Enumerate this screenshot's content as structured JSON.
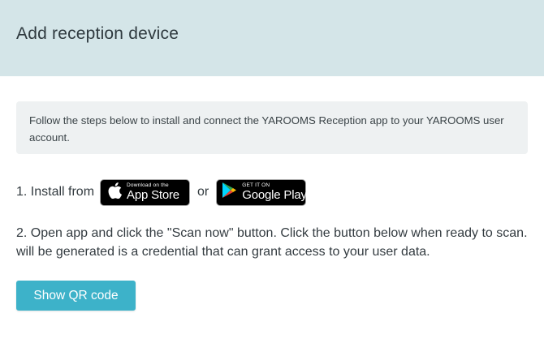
{
  "header": {
    "title": "Add reception device"
  },
  "info": {
    "text": "Follow the steps below to install and connect the YAROOMS Reception app to your YAROOMS user account."
  },
  "step1": {
    "label": "1. Install from",
    "or": "or",
    "app_store": {
      "small": "Download on the",
      "big": "App Store",
      "icon": "apple-icon"
    },
    "google_play": {
      "small": "GET IT ON",
      "big": "Google Play",
      "icon": "google-play-icon"
    }
  },
  "step2": {
    "line1": "2. Open app and click the \"Scan now\" button. Click the button below when ready to scan.",
    "line2": "will be generated is a credential that can grant access to your user data."
  },
  "qr_button": {
    "label": "Show QR code"
  },
  "colors": {
    "header_bg": "#d4e5e8",
    "info_bg": "#eef1f2",
    "button": "#3db2c9"
  }
}
